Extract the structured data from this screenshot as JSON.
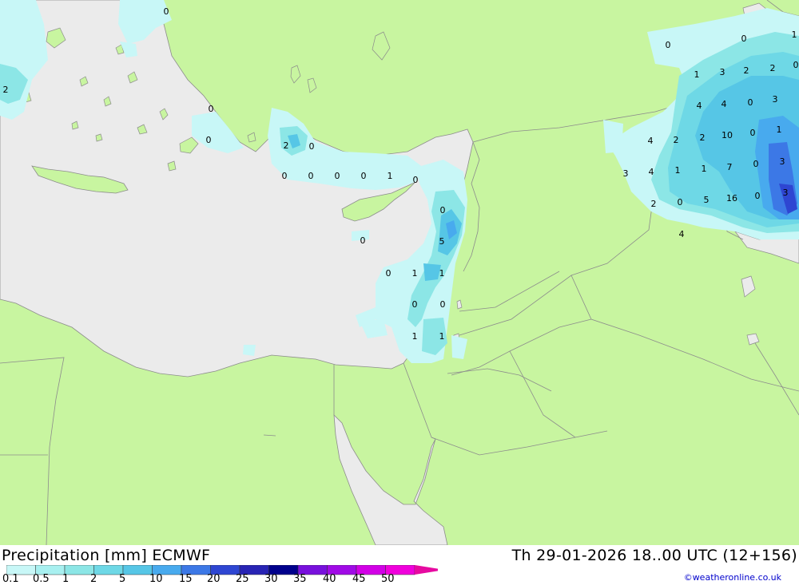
{
  "header": {
    "product": "Precipitation [mm] ECMWF",
    "valid_time": "Th 29-01-2026 18..00 UTC (12+156)"
  },
  "colors": {
    "sea": "#ebebeb",
    "land": "#c8f5a0",
    "border": "#8c8c8c"
  },
  "legend": {
    "labels": [
      "0.1",
      "0.5",
      "1",
      "2",
      "5",
      "10",
      "15",
      "20",
      "25",
      "30",
      "35",
      "40",
      "45",
      "50"
    ],
    "colors": [
      "#c8f7f7",
      "#a8f0f0",
      "#8ce6e6",
      "#6ed8e6",
      "#56c6e6",
      "#48aaee",
      "#3c78e6",
      "#2e46d2",
      "#2824b4",
      "#00008c",
      "#7810dc",
      "#a00ae6",
      "#d200e6",
      "#f000dc",
      "#e60aa0"
    ]
  },
  "credit": "©weatheronline.co.uk",
  "map_values": [
    "0",
    "2",
    "0",
    "0",
    "2",
    "0",
    "0",
    "0",
    "0",
    "0",
    "1",
    "0",
    "0",
    "5",
    "0",
    "0",
    "1",
    "1",
    "0",
    "0",
    "1",
    "1",
    "0",
    "0",
    "1",
    "2",
    "2",
    "0",
    "1",
    "3",
    "4",
    "4",
    "0",
    "3",
    "4",
    "2",
    "2",
    "10",
    "0",
    "1",
    "3",
    "4",
    "1",
    "1",
    "7",
    "0",
    "3",
    "2",
    "0",
    "5",
    "16",
    "0",
    "3",
    "4"
  ]
}
